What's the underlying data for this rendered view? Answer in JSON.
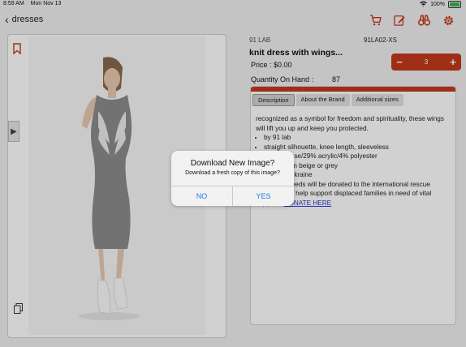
{
  "status": {
    "time": "8:59 AM",
    "date": "Mon Nov 13",
    "battery": "100%"
  },
  "nav": {
    "back_label": "dresses"
  },
  "icons": [
    "cart-icon",
    "edit-icon",
    "binoculars-icon",
    "gear-icon"
  ],
  "accent_color": "#c4391c",
  "product": {
    "brand": "91 LAB",
    "sku": "91LA02-XS",
    "title": "knit dress with wings...",
    "price": "Price : $0.00",
    "qoh_label": "Quantity On Hand :",
    "qoh_value": "87",
    "quantity": "3"
  },
  "tabs": [
    "Description",
    "About the Brand",
    "Additional sizes"
  ],
  "description": {
    "intro": "recognized as a symbol for freedom and spirituality, these wings will lift you up and keep you protected.",
    "bullets": [
      "by 91 lab",
      "straight silhouette, knee length, sleeveless",
      "67% viscose/29% acrylic/4% polyester",
      "available in beige or grey",
      "made in Ukraine"
    ],
    "charity": "10% of proceeds will be donated to the international rescue committee to help support displaced families in need of vital supplies.",
    "donate_link": "DONATE HERE"
  },
  "dialog": {
    "title": "Download New Image?",
    "message": "Download a fresh copy of this image?",
    "no": "NO",
    "yes": "YES"
  }
}
